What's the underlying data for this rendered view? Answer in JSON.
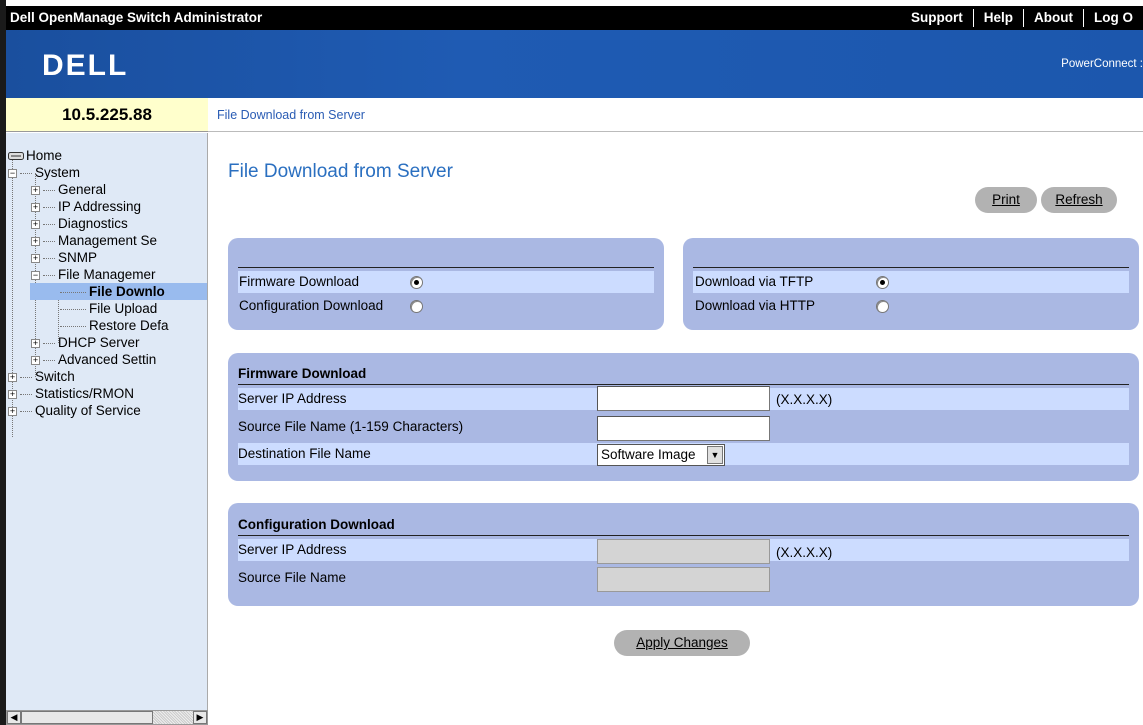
{
  "window": {
    "title": "Dell OpenManage Switch Administrator",
    "links": [
      "Support",
      "Help",
      "About",
      "Log O"
    ]
  },
  "banner": {
    "logo": "DELL",
    "product": "PowerConnect :"
  },
  "device_ip": "10.5.225.88",
  "breadcrumb": "File Download from Server",
  "tree": [
    {
      "label": "Home",
      "icon": "switch-device-icon"
    },
    {
      "label": "System",
      "expand": "-"
    },
    {
      "label": "General",
      "expand": "+"
    },
    {
      "label": "IP Addressing",
      "expand": "+"
    },
    {
      "label": "Diagnostics",
      "expand": "+"
    },
    {
      "label": "Management Se",
      "expand": "+"
    },
    {
      "label": "SNMP",
      "expand": "+"
    },
    {
      "label": "File Managemer",
      "expand": "-"
    },
    {
      "label": "File Downlo",
      "selected": true
    },
    {
      "label": "File Upload"
    },
    {
      "label": "Restore Defa"
    },
    {
      "label": "DHCP Server",
      "expand": "+"
    },
    {
      "label": "Advanced Settin",
      "expand": "+"
    },
    {
      "label": "Switch",
      "expand": "+"
    },
    {
      "label": "Statistics/RMON",
      "expand": "+"
    },
    {
      "label": "Quality of Service",
      "expand": "+"
    }
  ],
  "page": {
    "title": "File Download from Server",
    "print_label": "Print",
    "refresh_label": "Refresh",
    "apply_label": "Apply Changes"
  },
  "download_type": {
    "firmware_label": "Firmware Download",
    "configuration_label": "Configuration Download",
    "selected": "firmware"
  },
  "download_method": {
    "tftp_label": "Download via TFTP",
    "http_label": "Download via HTTP",
    "selected": "tftp"
  },
  "firmware_download": {
    "header": "Firmware Download",
    "server_ip_label": "Server IP Address",
    "server_ip_value": "",
    "server_ip_hint": "(X.X.X.X)",
    "source_file_label": "Source File Name (1-159 Characters)",
    "source_file_value": "",
    "destination_label": "Destination File Name",
    "destination_value": "Software Image"
  },
  "configuration_download": {
    "header": "Configuration Download",
    "server_ip_label": "Server IP Address",
    "server_ip_value": "",
    "server_ip_hint": "(X.X.X.X)",
    "source_file_label": "Source File Name",
    "source_file_value": ""
  },
  "colors": {
    "panel": "#aab8e3",
    "row_highlight": "#ccdcff",
    "title_blue": "#2a6fc0",
    "banner_blue": "#1f5bb3",
    "ip_box": "#ffffcc"
  }
}
